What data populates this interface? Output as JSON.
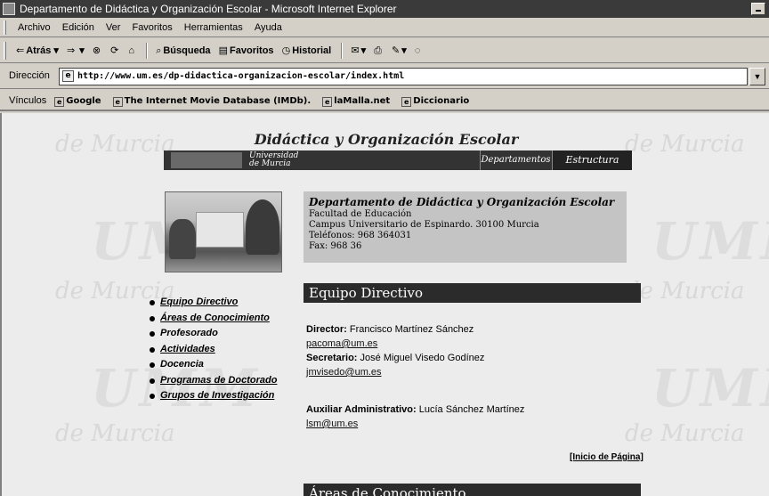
{
  "window": {
    "title": "Departamento de Didáctica y Organización Escolar - Microsoft Internet Explorer"
  },
  "menu": [
    "Archivo",
    "Edición",
    "Ver",
    "Favoritos",
    "Herramientas",
    "Ayuda"
  ],
  "toolbar": {
    "back": "Atrás",
    "search": "Búsqueda",
    "favorites": "Favoritos",
    "history": "Historial"
  },
  "address": {
    "label": "Dirección",
    "url": "http://www.um.es/dp-didactica-organizacion-escolar/index.html"
  },
  "links": {
    "label": "Vínculos",
    "items": [
      "Google",
      "The Internet Movie Database (IMDb).",
      "laMalla.net",
      "Diccionario"
    ]
  },
  "site": {
    "title": "Didáctica y Organización Escolar",
    "university_line1": "Universidad",
    "university_line2": "de Murcia",
    "nav": [
      "Departamentos",
      "Estructura"
    ]
  },
  "dept": {
    "name": "Departamento de Didáctica y Organización Escolar",
    "faculty": "Facultad de Educación",
    "campus": "Campus Universitario de Espinardo. 30100 Murcia",
    "phones": "Teléfonos: 968 364031",
    "fax": "Fax: 968 36"
  },
  "sidemenu": [
    "Equipo Directivo",
    "Áreas de Conocimiento",
    "Profesorado",
    "Actividades",
    "Docencia",
    "Programas de Doctorado",
    "Grupos de Investigación"
  ],
  "section1": {
    "title": "Equipo Directivo",
    "director_label": "Director:",
    "director_name": "Francisco Martínez Sánchez",
    "director_email": "pacoma@um.es",
    "secretary_label": "Secretario:",
    "secretary_name": "José Miguel Visedo Godínez",
    "secretary_email": "jmvisedo@um.es",
    "aux_label": "Auxiliar Administrativo:",
    "aux_name": "Lucía Sánchez Martínez",
    "aux_email": "lsm@um.es",
    "top_link": "[Inicio de Página]"
  },
  "section2": {
    "title": "Áreas de Conocimiento"
  },
  "watermark": {
    "script": "de Murcia",
    "logo": "UMM"
  }
}
